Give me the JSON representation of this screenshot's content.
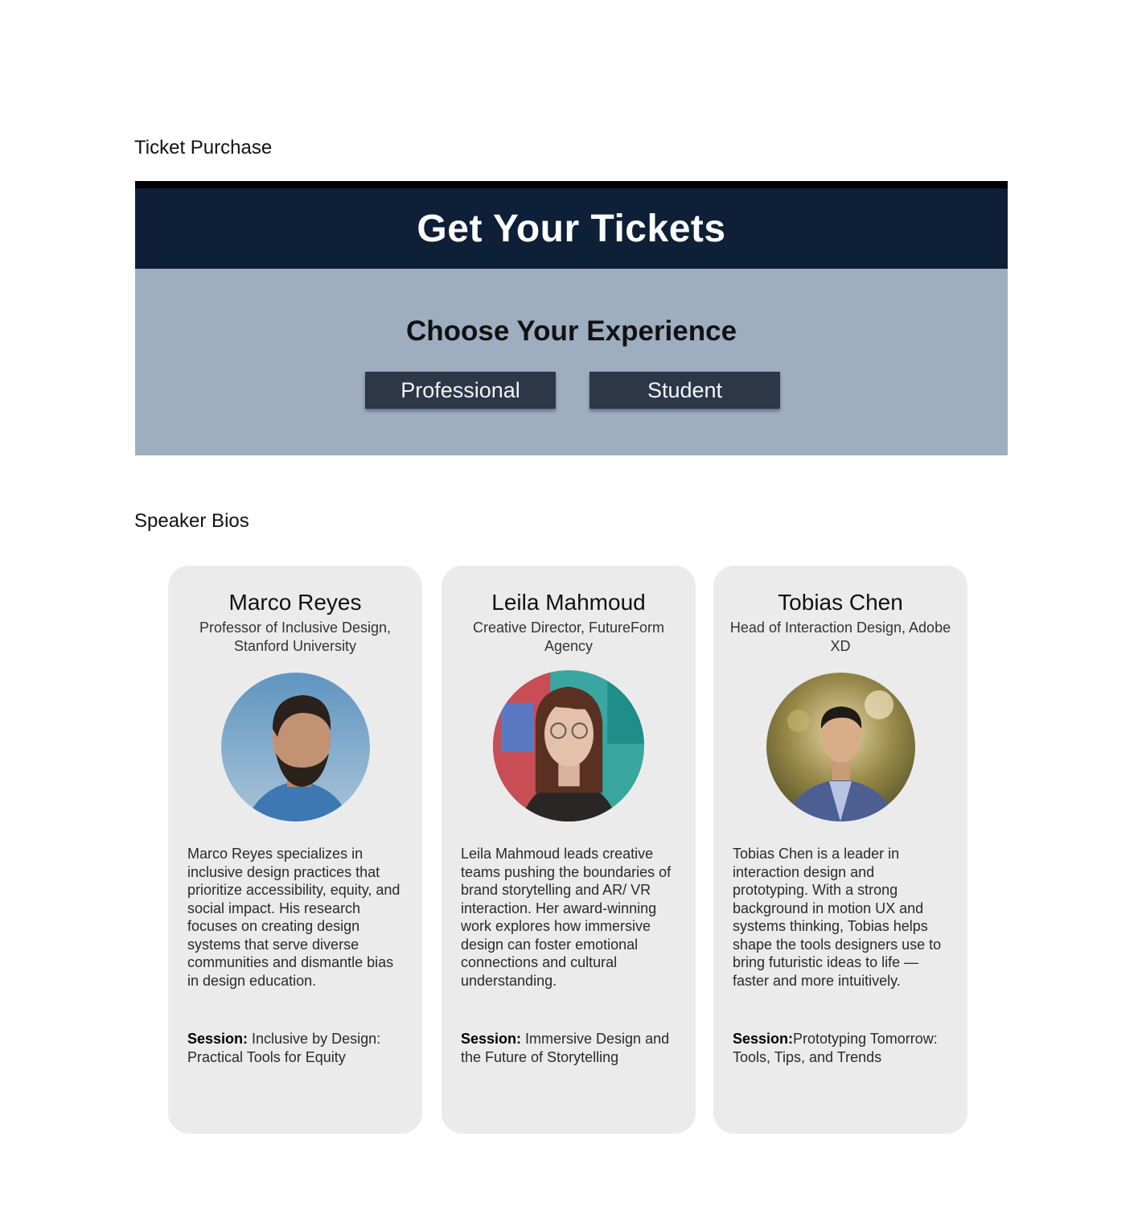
{
  "sections": {
    "ticket_label": "Ticket Purchase",
    "speaker_label": "Speaker Bios"
  },
  "tickets": {
    "title": "Get Your Tickets",
    "subtitle": "Choose Your Experience",
    "options": [
      "Professional",
      "Student"
    ],
    "colors": {
      "header": "#0e1f38",
      "body": "#9eaec0",
      "button": "#2d3748"
    }
  },
  "speakers": [
    {
      "name": "Marco Reyes",
      "role": "Professor of Inclusive Design, Stanford University",
      "bio": "Marco Reyes specializes in inclusive design practices that prioritize accessibility, equity, and social impact. His research focuses on creating design systems that serve diverse communities and dismantle bias in design education.",
      "session_label": "Session:",
      "session_title": " Inclusive by Design: Practical Tools for Equity"
    },
    {
      "name": "Leila Mahmoud",
      "role": "Creative Director, FutureForm Agency",
      "bio": "Leila Mahmoud leads creative teams pushing the boundaries of brand storytelling and AR/ VR interaction. Her award-winning work explores how immersive design can foster emotional connections and cultural understanding.",
      "session_label": "Session:",
      "session_title": " Immersive Design and the Future of Storytelling"
    },
    {
      "name": "Tobias Chen",
      "role": "Head of Interaction Design, Adobe XD",
      "bio": "Tobias Chen is a leader in interaction design and prototyping. With a strong background in motion UX and systems thinking, Tobias helps shape the tools designers use to bring futuristic ideas to life —faster and more intuitively.",
      "session_label": "Session:",
      "session_title": "Prototyping Tomorrow: Tools, Tips, and Trends"
    }
  ]
}
